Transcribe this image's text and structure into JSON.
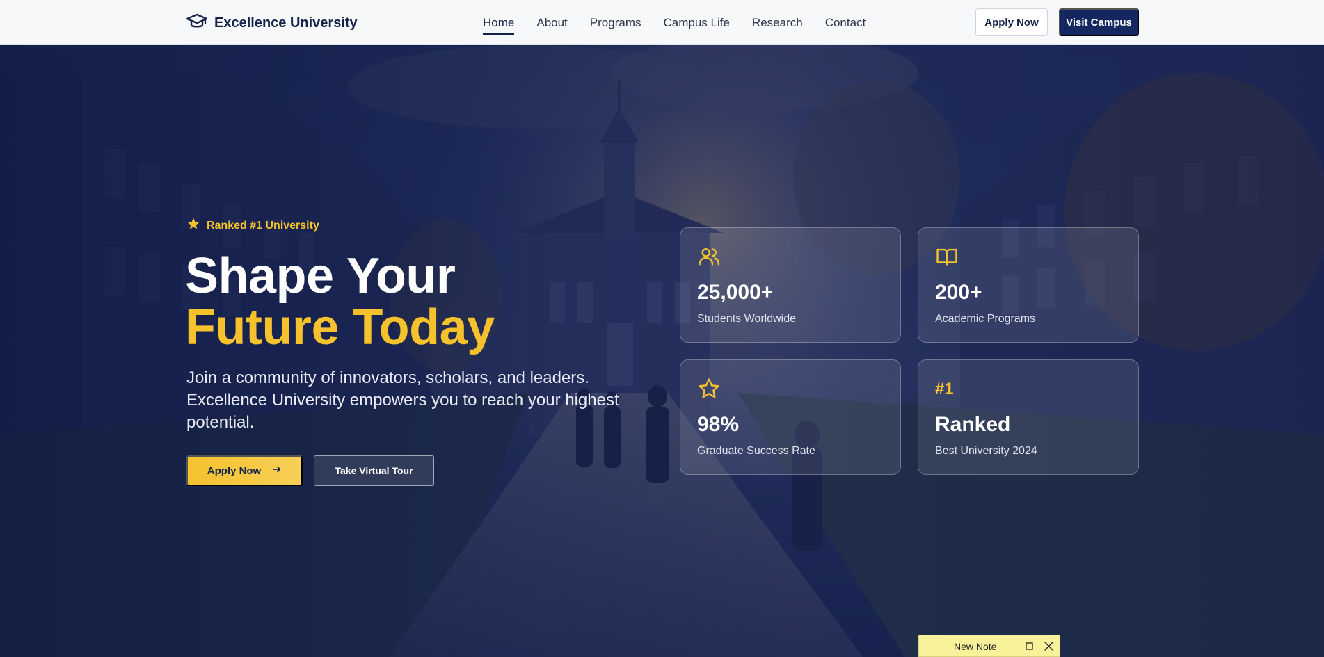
{
  "nav": {
    "brand_name": "Excellence University",
    "brand_icon": "graduation-cap-icon",
    "links": [
      {
        "label": "Home",
        "active": true
      },
      {
        "label": "About"
      },
      {
        "label": "Programs"
      },
      {
        "label": "Campus Life"
      },
      {
        "label": "Research"
      },
      {
        "label": "Contact"
      }
    ],
    "apply_label": "Apply Now",
    "visit_label": "Visit Campus"
  },
  "hero": {
    "badge_text": "Ranked #1 University",
    "badge_icon": "star-icon",
    "headline_line1": "Shape Your",
    "headline_line2": "Future Today",
    "lead": "Join a community of innovators, scholars, and leaders. Excellence University empowers you to reach your highest potential.",
    "apply_button": "Apply Now",
    "tour_button": "Take Virtual Tour"
  },
  "stats": [
    {
      "icon": "users-icon",
      "value": "25,000+",
      "label": "Students Worldwide"
    },
    {
      "icon": "book-open-icon",
      "value": "200+",
      "label": "Academic Programs"
    },
    {
      "icon": "star-outline-icon",
      "value": "98%",
      "label": "Graduate Success Rate"
    },
    {
      "tag": "#1",
      "value": "Ranked",
      "label": "Best University 2024"
    }
  ],
  "note": {
    "title": "New Note"
  },
  "colors": {
    "navy": "#14224a",
    "accent": "#f5c22e",
    "nav_bg": "#f7f8fa"
  }
}
